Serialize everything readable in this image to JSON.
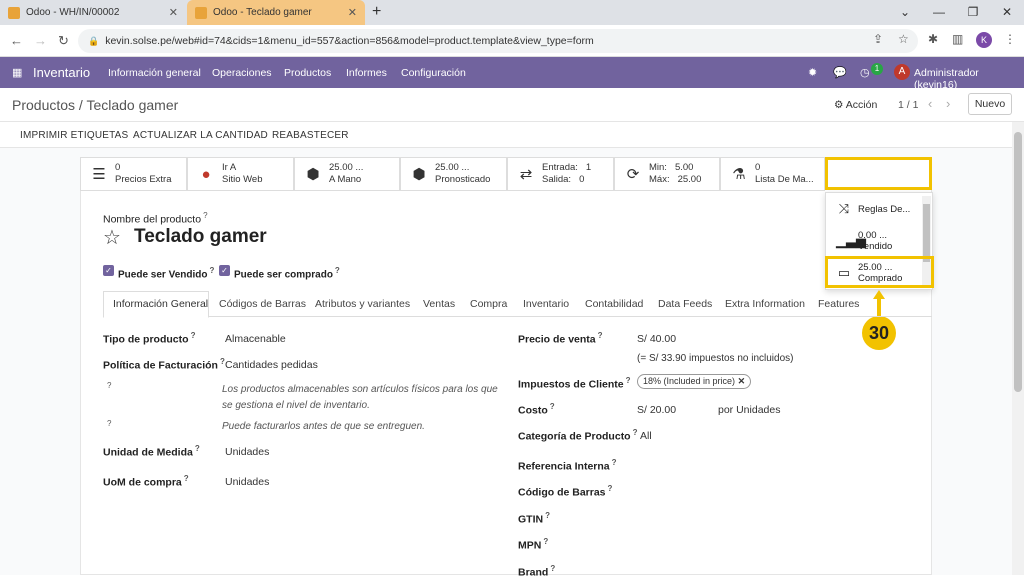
{
  "browser": {
    "tabs": [
      {
        "label": "Odoo - WH/IN/00002"
      },
      {
        "label": "Odoo - Teclado gamer"
      }
    ],
    "url": "kevin.solse.pe/web#id=74&cids=1&menu_id=557&action=856&model=product.template&view_type=form",
    "profile_initial": "K"
  },
  "odoo_nav": {
    "app_name": "Inventario",
    "menus": [
      "Información general",
      "Operaciones",
      "Productos",
      "Informes",
      "Configuración"
    ],
    "activity_count": "1",
    "user_initial": "A",
    "user_name": "Administrador (kevin16)"
  },
  "control_panel": {
    "breadcrumb": "Productos / Teclado gamer",
    "action_label": "Acción",
    "pager": "1 / 1",
    "new_button": "Nuevo"
  },
  "header_buttons": [
    "IMPRIMIR ETIQUETAS",
    "ACTUALIZAR LA CANTIDAD",
    "REABASTECER"
  ],
  "smart_buttons": [
    {
      "top": "0",
      "bottom": "Precios Extra",
      "icon": "list-icon"
    },
    {
      "top": "Ir A",
      "bottom": "Sitio Web",
      "icon": "globe-icon"
    },
    {
      "top": "25.00 ...",
      "bottom": "A Mano",
      "icon": "cubes-icon"
    },
    {
      "top": "25.00 ...",
      "bottom": "Pronosticado",
      "icon": "cubes-icon"
    },
    {
      "l1": "Entrada:",
      "v1": "1",
      "l2": "Salida:",
      "v2": "0",
      "icon": "exchange-icon"
    },
    {
      "l1": "Min:",
      "v1": "5.00",
      "l2": "Máx:",
      "v2": "25.00",
      "icon": "refresh-icon"
    },
    {
      "top": "0",
      "bottom": "Lista De Ma...",
      "icon": "flask-icon"
    }
  ],
  "more_dropdown": [
    {
      "top": "Reglas De...",
      "bottom": "",
      "icon": "random-icon"
    },
    {
      "top": "0.00 ...",
      "bottom": "Vendido",
      "icon": "signal-icon"
    },
    {
      "top": "25.00 ...",
      "bottom": "Comprado",
      "icon": "credit-card-icon"
    }
  ],
  "callout_number": "30",
  "form": {
    "name_label": "Nombre del producto",
    "product_name": "Teclado gamer",
    "can_be_sold": "Puede ser Vendido",
    "can_be_purchased": "Puede ser comprado",
    "tabs": [
      "Información General",
      "Códigos de Barras",
      "Atributos y variantes",
      "Ventas",
      "Compra",
      "Inventario",
      "Contabilidad",
      "Data Feeds",
      "Extra Information",
      "Features"
    ],
    "left": {
      "product_type_label": "Tipo de producto",
      "product_type": "Almacenable",
      "invoice_policy_label": "Política de Facturación",
      "invoice_policy": "Cantidades pedidas",
      "note1": "Los productos almacenables son artículos físicos para los que se gestiona el nivel de inventario.",
      "note2": "Puede facturarlos antes de que se entreguen.",
      "uom_label": "Unidad de Medida",
      "uom": "Unidades",
      "uom_po_label": "UoM de compra",
      "uom_po": "Unidades"
    },
    "right": {
      "sale_price_label": "Precio de venta",
      "sale_price": "S/ 40.00",
      "sale_price_note": "(= S/ 33.90 impuestos no incluidos)",
      "customer_taxes_label": "Impuestos de Cliente",
      "customer_tax": "18% (Included in price)",
      "cost_label": "Costo",
      "cost": "S/ 20.00",
      "cost_unit": "por Unidades",
      "category_label": "Categoría de Producto",
      "category": "All",
      "internal_ref_label": "Referencia Interna",
      "barcode_label": "Código de Barras",
      "gtin_label": "GTIN",
      "mpn_label": "MPN",
      "brand_label": "Brand"
    }
  }
}
